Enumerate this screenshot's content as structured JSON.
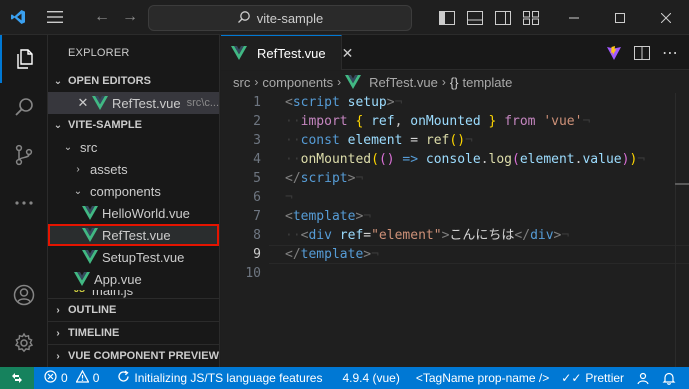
{
  "titlebar": {
    "search_text": "vite-sample",
    "icons": [
      "vscode-logo",
      "menu-icon",
      "arrow-left-icon",
      "arrow-right-icon",
      "search-icon",
      "toggle-sidebar-icon",
      "toggle-panel-icon",
      "toggle-secondary-sidebar-icon",
      "customize-layout-icon",
      "minimize-icon",
      "maximize-icon",
      "close-icon"
    ]
  },
  "activity_bar": [
    "explorer-icon",
    "search-icon",
    "source-control-icon",
    "more-icon",
    "accounts-icon",
    "manage-gear-icon"
  ],
  "sidebar": {
    "title": "EXPLORER",
    "open_editors": {
      "label": "OPEN EDITORS",
      "items": [
        {
          "name": "RefTest.vue",
          "path": "src\\c..."
        }
      ]
    },
    "workspace": {
      "label": "VITE-SAMPLE",
      "tree": [
        {
          "label": "src",
          "kind": "folder-open",
          "depth": 1
        },
        {
          "label": "assets",
          "kind": "folder-closed",
          "depth": 2
        },
        {
          "label": "components",
          "kind": "folder-open",
          "depth": 2
        },
        {
          "label": "HelloWorld.vue",
          "kind": "vue-file",
          "depth": 3
        },
        {
          "label": "RefTest.vue",
          "kind": "vue-file",
          "depth": 3,
          "selected": true
        },
        {
          "label": "SetupTest.vue",
          "kind": "vue-file",
          "depth": 3
        },
        {
          "label": "App.vue",
          "kind": "vue-file",
          "depth": 2
        },
        {
          "label": "main.js",
          "kind": "js-file",
          "depth": 2
        }
      ]
    },
    "sections": [
      "OUTLINE",
      "TIMELINE",
      "VUE COMPONENT PREVIEW"
    ]
  },
  "editor": {
    "tab_label": "RefTest.vue",
    "breadcrumb": [
      "src",
      "components",
      "RefTest.vue",
      "template"
    ],
    "line_numbers": [
      "1",
      "2",
      "3",
      "4",
      "5",
      "6",
      "7",
      "8",
      "9",
      "10"
    ],
    "current_line": "9"
  },
  "statusbar": {
    "errors": "0",
    "warnings": "0",
    "initializing": "Initializing JS/TS language features",
    "version": "4.9.4 (vue)",
    "tagname": "<TagName prop-name />",
    "prettier": "Prettier"
  },
  "colors": {
    "accent": "#0078d4",
    "remote": "#16825d",
    "selection_outline": "#e51400",
    "vue_green": "#41b883"
  }
}
